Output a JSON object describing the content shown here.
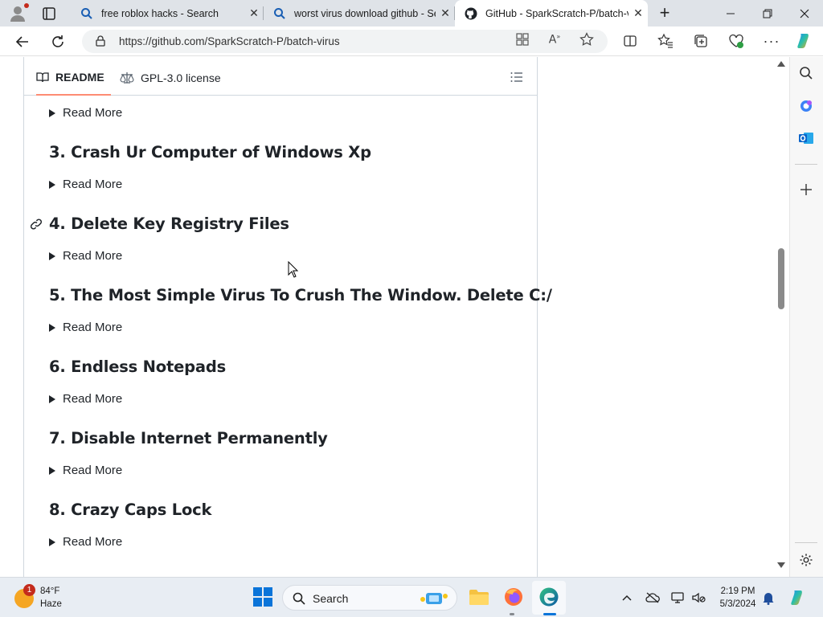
{
  "browser": {
    "tabs": [
      {
        "title": "free roblox hacks - Search",
        "active": false
      },
      {
        "title": "worst virus download github - Se",
        "active": false
      },
      {
        "title": "GitHub - SparkScratch-P/batch-v",
        "active": true
      }
    ],
    "url": "https://github.com/SparkScratch-P/batch-virus"
  },
  "readme": {
    "tab_readme": "README",
    "tab_license": "GPL-3.0 license",
    "read_more": "Read More",
    "headings": [
      "3. Crash Ur Computer of Windows Xp",
      "4. Delete Key Registry Files",
      "5. The Most Simple Virus To Crush The Window. Delete C:/",
      "6. Endless Notepads",
      "7. Disable Internet Permanently",
      "8. Crazy Caps Lock"
    ]
  },
  "taskbar": {
    "weather_badge": "1",
    "weather_temp": "84°F",
    "weather_cond": "Haze",
    "search_label": "Search",
    "time": "2:19 PM",
    "date": "5/3/2024"
  },
  "colors": {
    "accent": "#fd8c73",
    "border": "#d0d7de",
    "text": "#1f2328"
  }
}
